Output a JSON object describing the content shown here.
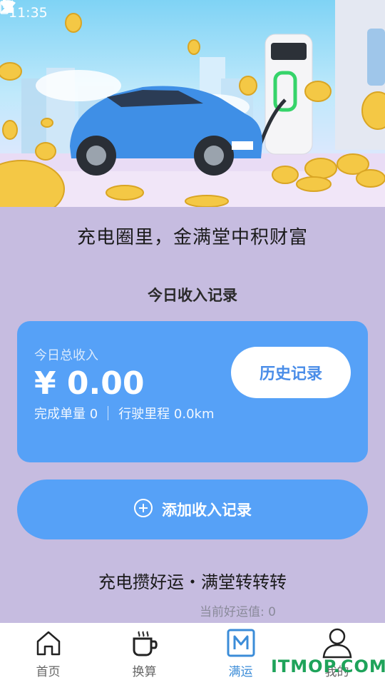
{
  "status_bar": {
    "time": "11:35"
  },
  "slogan": "充电圈里，金满堂中积财富",
  "section_title": "今日收入记录",
  "income_card": {
    "label": "今日总收入",
    "amount": "¥ 0.00",
    "orders": "完成单量 0",
    "mileage": "行驶里程 0.0km",
    "history_button": "历史记录"
  },
  "add_button": {
    "label": "添加收入记录"
  },
  "luck": {
    "title": "充电攒好运・满堂转转转",
    "value": "当前好运值: 0"
  },
  "nav": {
    "items": [
      {
        "label": "首页",
        "icon": "home-icon"
      },
      {
        "label": "换算",
        "icon": "cup-icon"
      },
      {
        "label": "满运",
        "icon": "m-logo-icon"
      },
      {
        "label": "我的",
        "icon": "user-icon"
      }
    ],
    "active_color": "#3b8cd8"
  },
  "watermark": "ITMOP.COM",
  "colors": {
    "background": "#c6bce0",
    "card": "#56a1f7",
    "accent": "#4a8de8"
  }
}
